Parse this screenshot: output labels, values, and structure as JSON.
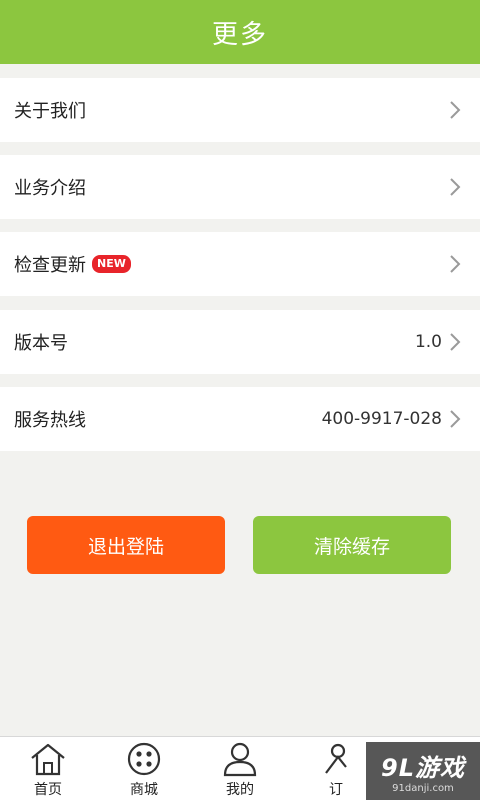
{
  "header": {
    "title": "更多"
  },
  "menu": [
    {
      "label": "关于我们",
      "value": "",
      "badge": ""
    },
    {
      "label": "业务介绍",
      "value": "",
      "badge": ""
    },
    {
      "label": "检查更新",
      "value": "",
      "badge": "NEW"
    },
    {
      "label": "版本号",
      "value": "1.0",
      "badge": ""
    },
    {
      "label": "服务热线",
      "value": "400-9917-028",
      "badge": ""
    }
  ],
  "buttons": {
    "logout": "退出登陆",
    "clear_cache": "清除缓存"
  },
  "tabs": [
    {
      "label": "首页",
      "icon": "home-icon"
    },
    {
      "label": "商城",
      "icon": "shop-icon"
    },
    {
      "label": "我的",
      "icon": "user-icon"
    },
    {
      "label": "订",
      "icon": "order-icon"
    }
  ],
  "watermark": {
    "main": "9L游戏",
    "sub": "91danji.com"
  },
  "colors": {
    "brand_green": "#8cc63f",
    "logout_orange": "#ff5a12",
    "badge_red": "#e8242a"
  }
}
